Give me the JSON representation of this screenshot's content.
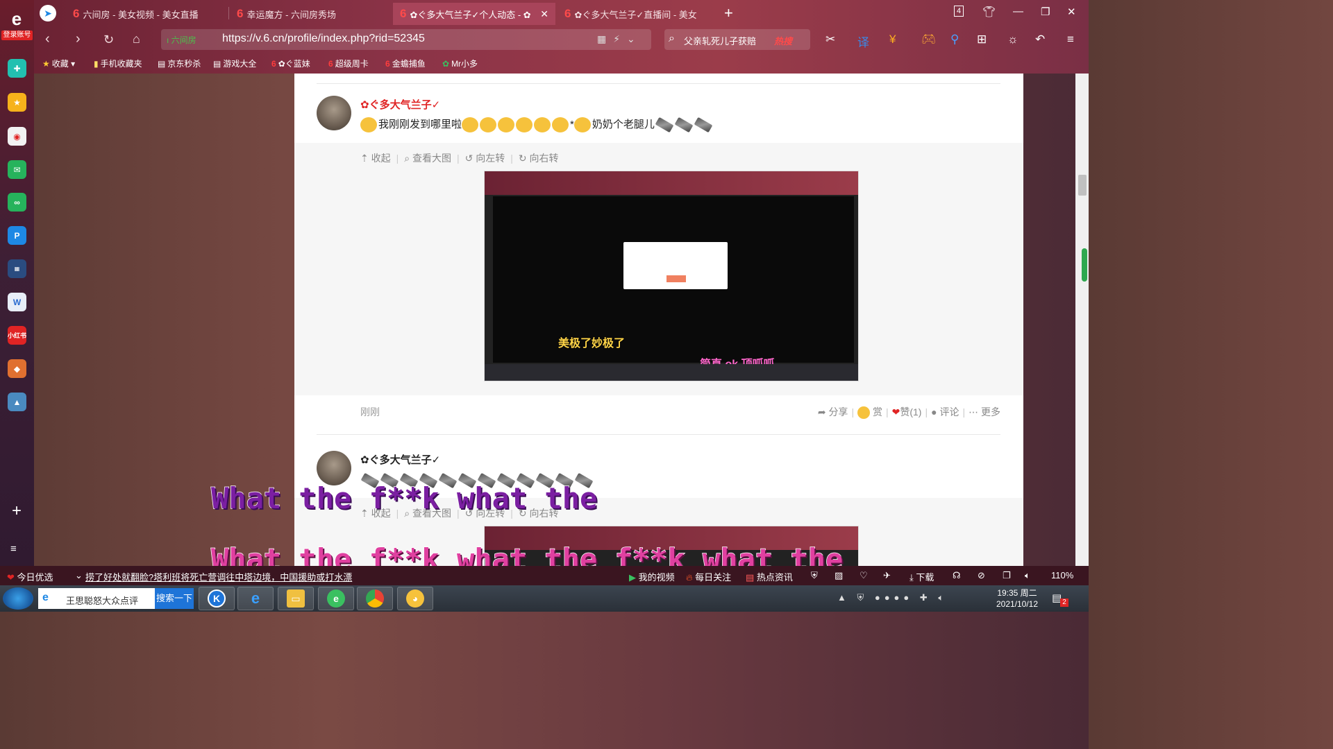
{
  "sidebar": {
    "login_label": "登录账号",
    "icons": [
      "add-icon",
      "star-icon",
      "weibo-icon",
      "mail-icon",
      "chat-icon",
      "p-icon",
      "game-icon",
      "word-icon",
      "xiaohongshu-icon",
      "game2-icon",
      "map-icon"
    ],
    "xiaohongshu_label": "小红书"
  },
  "tabs": [
    {
      "label": "六间房 - 美女视频 - 美女直播"
    },
    {
      "label": "幸运魔方 - 六间房秀场"
    },
    {
      "label": "✿ぐ多大气兰子✓个人动态 - ✿"
    },
    {
      "label": "✿ぐ多大气兰子✓直播间 - 美女"
    }
  ],
  "tab_count": "4",
  "address": {
    "site_badge": "六间房",
    "url": "https://v.6.cn/profile/index.php?rid=52345"
  },
  "search": {
    "query": "父亲轧死儿子获赔",
    "hot_label": "热搜"
  },
  "bookmarks": [
    "收藏",
    "手机收藏夹",
    "京东秒杀",
    "游戏大全",
    "✿ぐ蓝妹",
    "超级周卡",
    "金蟾捕鱼",
    "Mr小多"
  ],
  "posts": [
    {
      "author": "✿ぐ多大气兰子✓",
      "text_a": "我刚刚发到哪里啦",
      "text_b": "*",
      "text_c": "奶奶个老腿儿",
      "actions": [
        "收起",
        "查看大图",
        "向左转",
        "向右转"
      ],
      "thumb_caption_1": "美极了妙极了",
      "thumb_caption_2": "简直 ok 顶呱呱",
      "time": "刚刚",
      "foot_actions": [
        "分享",
        "赏",
        "赞(1)",
        "评论",
        "更多"
      ]
    },
    {
      "author": "✿ぐ多大气兰子✓",
      "actions": [
        "收起",
        "查看大图",
        "向左转",
        "向右转"
      ]
    }
  ],
  "subtitles": {
    "line1": "What the f**k what the",
    "line2": "What the f**k what the f**k what the"
  },
  "statusbar": {
    "today_pick": "今日优选",
    "news": "捞了好处就翻脸?塔利班将死亡营调往中塔边境，中国援助或打水漂",
    "my_video": "我的视频",
    "daily_follow": "每日关注",
    "hot_news": "热点资讯",
    "download": "下载",
    "zoom": "110%"
  },
  "taskbar": {
    "search_text": "王思聪怒大众点评",
    "search_button": "搜索一下",
    "time": "19:35 周二",
    "date": "2021/10/12",
    "notif_count": "2"
  }
}
